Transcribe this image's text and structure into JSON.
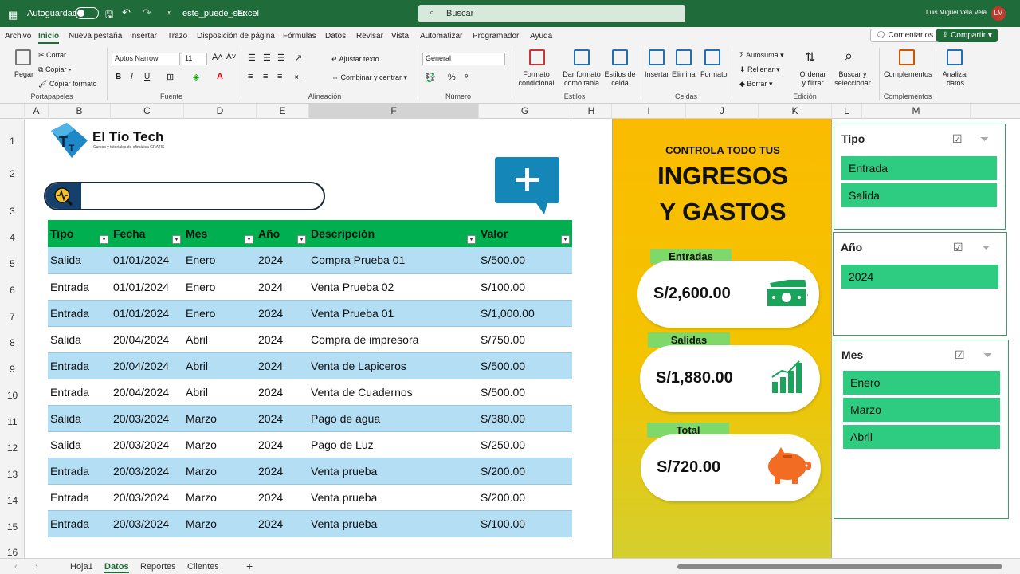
{
  "titlebar": {
    "autosave": "Autoguardado",
    "filename": "este_puede_ser",
    "app": "Excel",
    "search_placeholder": "Buscar",
    "user": "Luis Miguel Vela Vela",
    "initials": "LM"
  },
  "menu": {
    "items": [
      "Archivo",
      "Inicio",
      "Nueva pestaña",
      "Insertar",
      "Trazo",
      "Disposición de página",
      "Fórmulas",
      "Datos",
      "Revisar",
      "Vista",
      "Automatizar",
      "Programador",
      "Ayuda"
    ],
    "comments": "Comentarios",
    "share": "Compartir"
  },
  "ribbon": {
    "clipboard": {
      "paste": "Pegar",
      "cut": "Cortar",
      "copy": "Copiar",
      "format_painter": "Copiar formato",
      "group": "Portapapeles"
    },
    "font": {
      "name": "Aptos Narrow",
      "size": "11",
      "group": "Fuente",
      "b": "B",
      "i": "I",
      "u": "U"
    },
    "alignment": {
      "wrap": "Ajustar texto",
      "merge": "Combinar y centrar",
      "group": "Alineación"
    },
    "number": {
      "format": "General",
      "group": "Número"
    },
    "styles": {
      "cond": "Formato condicional",
      "table": "Dar formato como tabla",
      "cell": "Estilos de celda",
      "group": "Estilos"
    },
    "cells": {
      "insert": "Insertar",
      "delete": "Eliminar",
      "format": "Formato",
      "group": "Celdas"
    },
    "editing": {
      "autosum": "Autosuma",
      "fill": "Rellenar",
      "clear": "Borrar",
      "sort": "Ordenar y filtrar",
      "find": "Buscar y seleccionar",
      "group": "Edición"
    },
    "addins": {
      "addins": "Complementos",
      "analyze": "Analizar datos",
      "group": "Complementos"
    }
  },
  "columns": [
    "A",
    "B",
    "C",
    "D",
    "E",
    "F",
    "G",
    "H",
    "I",
    "J",
    "K",
    "L",
    "M"
  ],
  "rows": [
    "1",
    "2",
    "3",
    "4",
    "5",
    "6",
    "7",
    "8",
    "9",
    "10",
    "11",
    "12",
    "13",
    "14",
    "15",
    "16"
  ],
  "brand": {
    "name": "El Tío Tech",
    "tagline": "Cursos y tutoriales de ofimática GRATIS"
  },
  "table": {
    "headers": [
      "Tipo",
      "Fecha",
      "Mes",
      "Año",
      "Descripción",
      "Valor"
    ],
    "rows": [
      [
        "Salida",
        "01/01/2024",
        "Enero",
        "2024",
        "Compra Prueba 01",
        "S/500.00"
      ],
      [
        "Entrada",
        "01/01/2024",
        "Enero",
        "2024",
        "Venta Prueba 02",
        "S/100.00"
      ],
      [
        "Entrada",
        "01/01/2024",
        "Enero",
        "2024",
        "Venta Prueba 01",
        "S/1,000.00"
      ],
      [
        "Salida",
        "20/04/2024",
        "Abril",
        "2024",
        "Compra de impresora",
        "S/750.00"
      ],
      [
        "Entrada",
        "20/04/2024",
        "Abril",
        "2024",
        "Venta de Lapiceros",
        "S/500.00"
      ],
      [
        "Entrada",
        "20/04/2024",
        "Abril",
        "2024",
        "Venta de Cuadernos",
        "S/500.00"
      ],
      [
        "Salida",
        "20/03/2024",
        "Marzo",
        "2024",
        "Pago de agua",
        "S/380.00"
      ],
      [
        "Salida",
        "20/03/2024",
        "Marzo",
        "2024",
        "Pago de Luz",
        "S/250.00"
      ],
      [
        "Entrada",
        "20/03/2024",
        "Marzo",
        "2024",
        "Venta prueba",
        "S/200.00"
      ],
      [
        "Entrada",
        "20/03/2024",
        "Marzo",
        "2024",
        "Venta prueba",
        "S/200.00"
      ],
      [
        "Entrada",
        "20/03/2024",
        "Marzo",
        "2024",
        "Venta prueba",
        "S/100.00"
      ]
    ]
  },
  "dashboard": {
    "heading1": "CONTROLA TODO TUS",
    "heading2": "INGRESOS",
    "heading3": "Y GASTOS",
    "income": {
      "label": "Entradas",
      "value": "S/2,600.00"
    },
    "expenses": {
      "label": "Salidas",
      "value": "S/1,880.00"
    },
    "total": {
      "label": "Total",
      "value": "S/720.00"
    }
  },
  "slicers": [
    {
      "title": "Tipo",
      "items": [
        "Entrada",
        "Salida"
      ]
    },
    {
      "title": "Año",
      "items": [
        "2024"
      ]
    },
    {
      "title": "Mes",
      "items": [
        "Enero",
        "Marzo",
        "Abril"
      ]
    }
  ],
  "sheets": {
    "tabs": [
      "Hoja1",
      "Datos",
      "Reportes",
      "Clientes"
    ],
    "active": "Datos"
  },
  "colors": {
    "title_bar": "#1f6b3a",
    "table_header": "#00b050",
    "row_band": "#b3def4",
    "slicer_item": "#2ecc80",
    "dashboard": "#fbbb00",
    "kpi_label": "#7ed96a"
  }
}
